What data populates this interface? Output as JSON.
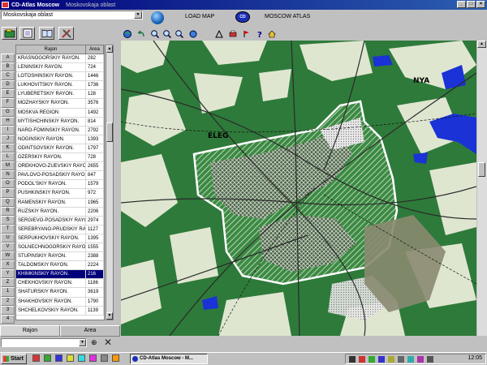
{
  "window": {
    "title": "CD-Atlas Moscow",
    "title_suffix": "Moskovskaja oblast",
    "controls": [
      "_",
      "□",
      "×"
    ]
  },
  "toolbar": {
    "region_select": "Moskovskaja oblast",
    "load_map_label": "LOAD MAP",
    "logo_text": "CD",
    "moscow_atlas_label": "MOSCOW ATLAS"
  },
  "letters": [
    "A",
    "B",
    "C",
    "D",
    "E",
    "F",
    "G",
    "H",
    "I",
    "J",
    "K",
    "L",
    "M",
    "N",
    "O",
    "P",
    "Q",
    "R",
    "S",
    "T",
    "U",
    "V",
    "W",
    "X",
    "Y",
    "Z",
    "1",
    "2",
    "3",
    "4"
  ],
  "table": {
    "headers": {
      "name": "Rajon",
      "area": "Area"
    },
    "rows": [
      {
        "name": "KRASNOGORSKIY RAYON.",
        "area": "282"
      },
      {
        "name": "LENINSKIY RAYON.",
        "area": "724"
      },
      {
        "name": "LOTOSHINSKIY RAYON.",
        "area": "1446"
      },
      {
        "name": "LUKHOVITSKIY RAYON.",
        "area": "1736"
      },
      {
        "name": "LYUBERETSKIY RAYON.",
        "area": "128"
      },
      {
        "name": "MOZHAYSKIY RAYON.",
        "area": "3576"
      },
      {
        "name": "MOSKVA REGION",
        "area": "1492"
      },
      {
        "name": "MYTISHCHINSKIY RAYON.",
        "area": "814"
      },
      {
        "name": "NARO-FOMINSKIY RAYON.",
        "area": "2792"
      },
      {
        "name": "NOGINSKIY RAYON.",
        "area": "1393"
      },
      {
        "name": "ODINTSOVSKIY RAYON.",
        "area": "1797"
      },
      {
        "name": "OZERSKIY RAYON.",
        "area": "728"
      },
      {
        "name": "OREKHOVO-ZUEVSKIY RAYON.",
        "area": "2655"
      },
      {
        "name": "PAVLOVO-POSADSKIY RAYON.",
        "area": "847"
      },
      {
        "name": "PODOL'SKIY RAYON.",
        "area": "1579"
      },
      {
        "name": "PUSHKINSKIY RAYON.",
        "area": "972"
      },
      {
        "name": "RAMENSKIY RAYON.",
        "area": "1965"
      },
      {
        "name": "RUZSKIY RAYON.",
        "area": "2206"
      },
      {
        "name": "SERGIEVO-POSADSKIY RAYON.",
        "area": "2974"
      },
      {
        "name": "SEREBRYANO-PRUDSKIY RAYON.",
        "area": "1127"
      },
      {
        "name": "SERPUKHOVSKIY RAYON.",
        "area": "1395"
      },
      {
        "name": "SOLNECHNOGORSKIY RAYON.",
        "area": "1555"
      },
      {
        "name": "STUPINSKIY RAYON.",
        "area": "2388"
      },
      {
        "name": "TALDOMSKIY RAYON.",
        "area": "2224"
      },
      {
        "name": "KHIMKINSKIY RAYON.",
        "area": "216"
      },
      {
        "name": "CHEKHOVSKIY RAYON.",
        "area": "1186"
      },
      {
        "name": "SHATURSKIY RAYON.",
        "area": "3619"
      },
      {
        "name": "SHAKHOVSKIY RAYON.",
        "area": "1790"
      },
      {
        "name": "SHCHELKOVSKIY RAYON.",
        "area": "1139"
      }
    ],
    "selected_row_index": 24
  },
  "panel_tabs": [
    "Rajon",
    "Area"
  ],
  "map": {
    "labels": [
      "ELEG",
      "NYA"
    ]
  },
  "taskbar": {
    "start_label": "Start",
    "task_button": "CD-Atlas Moscow - M...",
    "clock": "12:05"
  },
  "colors": {
    "title_bar": "#00007b",
    "forest": "#2e7a3a",
    "field": "#dfe6d0",
    "water": "#1a32d6",
    "selected_row": "#00007b"
  }
}
